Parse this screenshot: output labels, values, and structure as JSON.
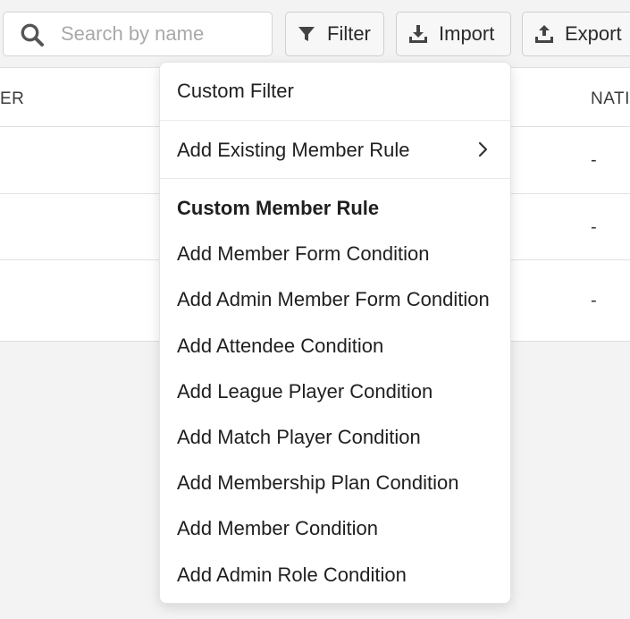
{
  "toolbar": {
    "search_placeholder": "Search by name",
    "filter_label": "Filter",
    "import_label": "Import",
    "export_label": "Export"
  },
  "table": {
    "headers": [
      "ER",
      "NATI"
    ],
    "rows": [
      {
        "value": "-"
      },
      {
        "value": "-"
      },
      {
        "value": "-"
      }
    ]
  },
  "menu": {
    "custom_filter": "Custom Filter",
    "add_existing_member_rule": "Add Existing Member Rule",
    "section_heading": "Custom Member Rule",
    "items": [
      "Add Member Form Condition",
      "Add Admin Member Form Condition",
      "Add Attendee Condition",
      "Add League Player Condition",
      "Add Match Player Condition",
      "Add Membership Plan Condition",
      "Add Member Condition",
      "Add Admin Role Condition"
    ]
  },
  "colors": {
    "background": "#f3f3f3",
    "surface": "#ffffff",
    "text": "#1f1f1f",
    "placeholder": "#a9a9a9",
    "border": "#cfcfcf"
  },
  "icons": {
    "search": "search-icon",
    "filter": "filter-icon",
    "import": "import-icon",
    "export": "export-icon",
    "submenu": "chevron-right-icon"
  }
}
